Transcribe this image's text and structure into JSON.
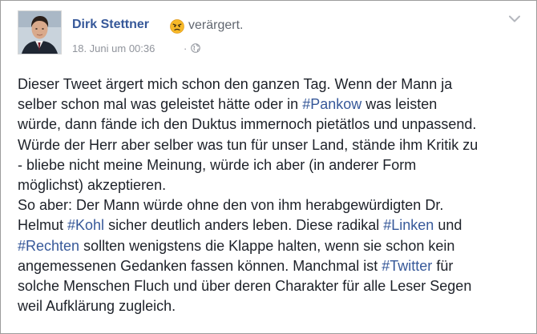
{
  "post": {
    "author_name": "Dirk Stettner",
    "mood_icon": "angry-face-icon",
    "mood_text": "verärgert.",
    "timestamp": "18. Juni um 00:36",
    "separator": "·",
    "privacy_icon": "globe-icon",
    "options_icon": "chevron-down-icon",
    "colors": {
      "link": "#365899",
      "text": "#1d2129",
      "meta": "#90949c"
    },
    "lines": [
      [
        {
          "text": "Dieser Tweet ärgert mich schon den ganzen Tag. Wenn der Mann ja"
        }
      ],
      [
        {
          "text": "selber schon mal was geleistet hätte oder in "
        },
        {
          "text": "#Pankow",
          "hashtag": true
        },
        {
          "text": " was leisten"
        }
      ],
      [
        {
          "text": "würde, dann fände ich den Duktus immernoch pietätlos und unpassend."
        }
      ],
      [
        {
          "text": "Würde der Herr aber selber was tun für unser Land, stände ihm Kritik zu"
        }
      ],
      [
        {
          "text": "- bliebe nicht meine Meinung, würde ich aber (in anderer Form"
        }
      ],
      [
        {
          "text": "möglichst) akzeptieren."
        }
      ],
      [
        {
          "text": "So aber: Der Mann würde ohne den von ihm herabgewürdigten Dr."
        }
      ],
      [
        {
          "text": "Helmut "
        },
        {
          "text": "#Kohl",
          "hashtag": true
        },
        {
          "text": " sicher deutlich anders leben. Diese radikal "
        },
        {
          "text": "#Linken",
          "hashtag": true
        },
        {
          "text": " und"
        }
      ],
      [
        {
          "text": "#Rechten",
          "hashtag": true
        },
        {
          "text": " sollten wenigstens die Klappe halten, wenn sie schon kein"
        }
      ],
      [
        {
          "text": "angemessenen Gedanken fassen können. Manchmal ist "
        },
        {
          "text": "#Twitter",
          "hashtag": true
        },
        {
          "text": " für"
        }
      ],
      [
        {
          "text": "solche Menschen Fluch und über deren Charakter für alle Leser Segen"
        }
      ],
      [
        {
          "text": "weil Aufklärung zugleich."
        }
      ]
    ]
  }
}
